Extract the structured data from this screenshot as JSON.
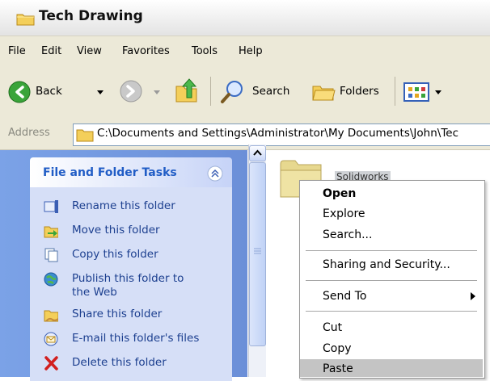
{
  "window": {
    "title": "Tech Drawing",
    "title_icon": "folder-icon"
  },
  "menubar": {
    "items": [
      "File",
      "Edit",
      "View",
      "Favorites",
      "Tools",
      "Help"
    ]
  },
  "toolbar": {
    "back_label": "Back",
    "search_label": "Search",
    "folders_label": "Folders",
    "icons": [
      "back-arrow-icon",
      "forward-arrow-icon",
      "up-folder-icon",
      "search-magnifier-icon",
      "folders-icon",
      "views-icon"
    ]
  },
  "address": {
    "label": "Address",
    "value": "C:\\Documents and Settings\\Administrator\\My Documents\\John\\Tec"
  },
  "tasks": {
    "title": "File and Folder Tasks",
    "items": [
      {
        "label": "Rename this folder",
        "icon": "rename-icon"
      },
      {
        "label": "Move this folder",
        "icon": "move-icon"
      },
      {
        "label": "Copy this folder",
        "icon": "copy-icon"
      },
      {
        "label": "Publish this folder to",
        "label2": "the Web",
        "icon": "globe-icon"
      },
      {
        "label": "Share this folder",
        "icon": "share-icon"
      },
      {
        "label": "E-mail this folder's files",
        "icon": "email-icon"
      },
      {
        "label": "Delete this folder",
        "icon": "delete-icon"
      }
    ]
  },
  "content": {
    "folder_name": "Solidworks"
  },
  "context_menu": {
    "items": [
      "Open",
      "Explore",
      "Search...",
      "Sharing and Security...",
      "Send To",
      "Cut",
      "Copy",
      "Paste"
    ],
    "default_item": "Open",
    "highlighted_item": "Paste"
  },
  "colors": {
    "menu_bg": "#ece9d8",
    "task_pane": "#6b8fd8",
    "task_link": "#1c3f8f",
    "highlight": "#c4c4c4"
  }
}
